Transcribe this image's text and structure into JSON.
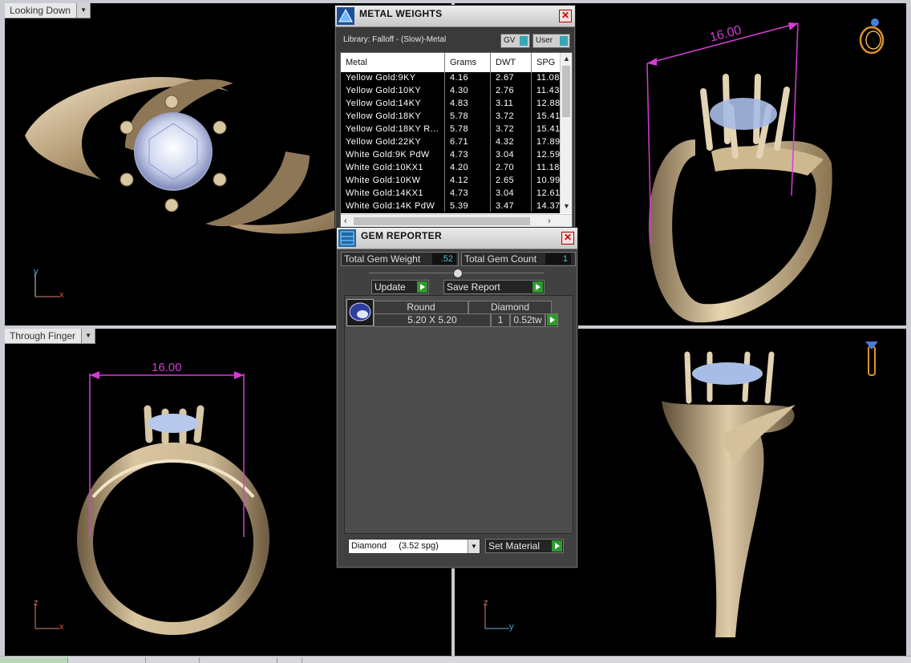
{
  "viewports": {
    "top_left_label": "Looking Down",
    "bottom_left_label": "Through Finger",
    "dimension_tr": "16.00",
    "dimension_bl": "16.00",
    "axis_tl": {
      "v": "y",
      "h": "x"
    },
    "axis_bl": {
      "v": "z",
      "h": "x"
    },
    "axis_br": {
      "v": "z",
      "h": "y"
    }
  },
  "metal_weights": {
    "title": "METAL WEIGHTS",
    "library": "Library: Falloff - (Slow)-Metal",
    "toggle_gv": "GV",
    "toggle_user": "User",
    "columns": [
      "Metal",
      "Grams",
      "DWT",
      "SPG"
    ],
    "rows": [
      {
        "metal": "Yellow Gold:9KY",
        "grams": "4.16",
        "dwt": "2.67",
        "spg": "11.08"
      },
      {
        "metal": "Yellow Gold:10KY",
        "grams": "4.30",
        "dwt": "2.76",
        "spg": "11.43"
      },
      {
        "metal": "Yellow Gold:14KY",
        "grams": "4.83",
        "dwt": "3.11",
        "spg": "12.88"
      },
      {
        "metal": "Yellow Gold:18KY",
        "grams": "5.78",
        "dwt": "3.72",
        "spg": "15.41"
      },
      {
        "metal": "Yellow Gold:18KY R...",
        "grams": "5.78",
        "dwt": "3.72",
        "spg": "15.41"
      },
      {
        "metal": "Yellow Gold:22KY",
        "grams": "6.71",
        "dwt": "4.32",
        "spg": "17.89"
      },
      {
        "metal": "White Gold:9K PdW",
        "grams": "4.73",
        "dwt": "3.04",
        "spg": "12.59"
      },
      {
        "metal": "White Gold:10KX1",
        "grams": "4.20",
        "dwt": "2.70",
        "spg": "11.18"
      },
      {
        "metal": "White Gold:10KW",
        "grams": "4.12",
        "dwt": "2.65",
        "spg": "10.99"
      },
      {
        "metal": "White Gold:14KX1",
        "grams": "4.73",
        "dwt": "3.04",
        "spg": "12.61"
      },
      {
        "metal": "White Gold:14K PdW",
        "grams": "5.39",
        "dwt": "3.47",
        "spg": "14.37"
      }
    ]
  },
  "gem_reporter": {
    "title": "GEM REPORTER",
    "total_weight_label": "Total Gem Weight",
    "total_weight_value": ".52",
    "total_count_label": "Total Gem Count",
    "total_count_value": "1",
    "update_label": "Update",
    "save_report_label": "Save Report",
    "gem": {
      "shape": "Round",
      "type": "Diamond",
      "size": "5.20 X 5.20",
      "qty": "1",
      "weight": "0.52tw"
    },
    "material_select": "Diamond     (3.52 spg)",
    "set_material_label": "Set Material"
  },
  "colors": {
    "gold": "#d6c2a0",
    "dimension": "#d53cd5",
    "accent": "#36a6b8"
  }
}
